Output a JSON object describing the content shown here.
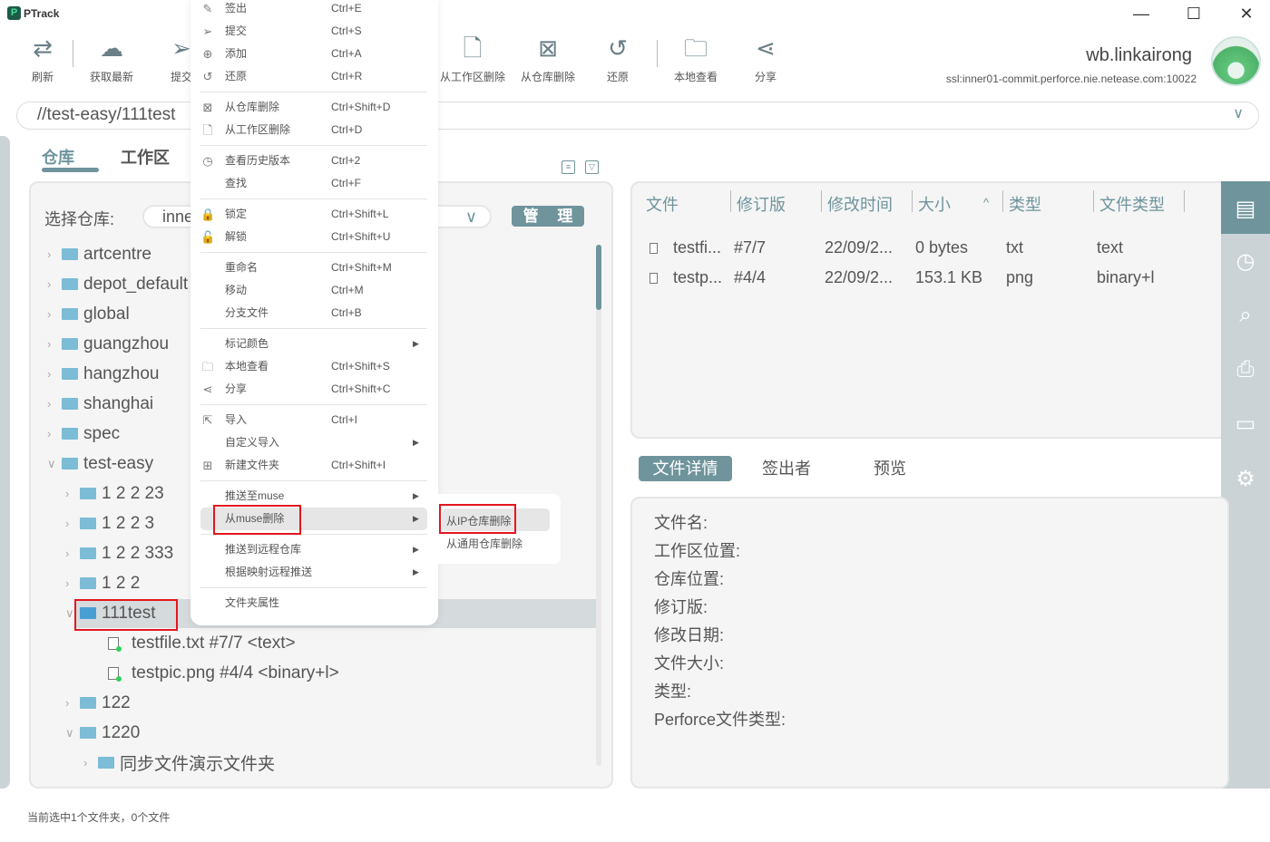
{
  "app": {
    "title": "PTrack",
    "colors": {
      "accent": "#6f949c",
      "highlight_box": "#e3161f",
      "status_dot": "#2ed15a"
    }
  },
  "window_controls": {
    "minimize": "—",
    "maximize": "☐",
    "close": "✕"
  },
  "toolbar": [
    {
      "label": "刷新",
      "icon": "refresh-icon",
      "glyph": "⇄"
    },
    {
      "label": "获取最新",
      "icon": "cloud-download-icon",
      "glyph": "☁"
    },
    {
      "label": "提交",
      "icon": "send-icon",
      "glyph": "➢"
    },
    {
      "label": "从工作区删除",
      "icon": "file-delete-icon",
      "glyph": "🗋"
    },
    {
      "label": "从仓库删除",
      "icon": "depot-delete-icon",
      "glyph": "⊠"
    },
    {
      "label": "还原",
      "icon": "revert-icon",
      "glyph": "↺"
    },
    {
      "label": "本地查看",
      "icon": "folder-open-icon",
      "glyph": "🗀"
    },
    {
      "label": "分享",
      "icon": "share-icon",
      "glyph": "⋖"
    }
  ],
  "user": {
    "name": "wb.linkairong",
    "server": "ssl:inner01-commit.perforce.nie.netease.com:10022"
  },
  "path": {
    "value": "//test-easy/111test"
  },
  "tabs": [
    "仓库",
    "工作区"
  ],
  "repo": {
    "label": "选择仓库:",
    "value": "inne",
    "manage": "管 理"
  },
  "tree": [
    {
      "label": "artcentre",
      "level": 0,
      "type": "folder",
      "expanded": false
    },
    {
      "label": "depot_default",
      "level": 0,
      "type": "folder",
      "expanded": false
    },
    {
      "label": "global",
      "level": 0,
      "type": "folder",
      "expanded": false
    },
    {
      "label": "guangzhou",
      "level": 0,
      "type": "folder",
      "expanded": false
    },
    {
      "label": "hangzhou",
      "level": 0,
      "type": "folder",
      "expanded": false
    },
    {
      "label": "shanghai",
      "level": 0,
      "type": "folder",
      "expanded": false
    },
    {
      "label": "spec",
      "level": 0,
      "type": "folder",
      "expanded": false
    },
    {
      "label": "test-easy",
      "level": 0,
      "type": "folder",
      "expanded": true
    },
    {
      "label": "1 2 2 23",
      "level": 1,
      "type": "folder",
      "expanded": false
    },
    {
      "label": "1 2 2 3",
      "level": 1,
      "type": "folder",
      "expanded": false
    },
    {
      "label": "1 2 2 333",
      "level": 1,
      "type": "folder",
      "expanded": false
    },
    {
      "label": "1 2 2",
      "level": 1,
      "type": "folder",
      "expanded": false
    },
    {
      "label": "111test",
      "level": 1,
      "type": "folder",
      "expanded": true,
      "selected": true
    },
    {
      "label": "testfile.txt  #7/7 <text>",
      "level": 2,
      "type": "file"
    },
    {
      "label": "testpic.png  #4/4 <binary+l>",
      "level": 2,
      "type": "file"
    },
    {
      "label": "122",
      "level": 1,
      "type": "folder",
      "expanded": false
    },
    {
      "label": "1220",
      "level": 1,
      "type": "folder",
      "expanded": true
    },
    {
      "label": "同步文件演示文件夹",
      "level": 2,
      "type": "folder",
      "expanded": false
    }
  ],
  "file_table": {
    "columns": [
      "文件",
      "修订版",
      "修改时间",
      "大小",
      "类型",
      "文件类型"
    ],
    "sort_indicator": "^",
    "rows": [
      [
        "testfi...",
        "#7/7",
        "22/09/2...",
        "0 bytes",
        "txt",
        "text"
      ],
      [
        "testp...",
        "#4/4",
        "22/09/2...",
        "153.1 KB",
        "png",
        "binary+l"
      ]
    ]
  },
  "right_sidebar": [
    "file-list-icon",
    "history-icon",
    "search-icon",
    "stamp-icon",
    "monitor-icon",
    "settings-icon"
  ],
  "detail_tabs": [
    "文件详情",
    "签出者",
    "预览"
  ],
  "details": [
    "文件名:",
    "工作区位置:",
    "仓库位置:",
    "修订版:",
    "修改日期:",
    "文件大小:",
    "类型:",
    "Perforce文件类型:"
  ],
  "status": "当前选中1个文件夹，0个文件",
  "context_menu": [
    {
      "label": "签出",
      "shortcut": "Ctrl+E",
      "icon": "✎"
    },
    {
      "label": "提交",
      "shortcut": "Ctrl+S",
      "icon": "➢"
    },
    {
      "label": "添加",
      "shortcut": "Ctrl+A",
      "icon": "⊕"
    },
    {
      "label": "还原",
      "shortcut": "Ctrl+R",
      "icon": "↺"
    },
    {
      "sep": true
    },
    {
      "label": "从仓库删除",
      "shortcut": "Ctrl+Shift+D",
      "icon": "⊠"
    },
    {
      "label": "从工作区删除",
      "shortcut": "Ctrl+D",
      "icon": "🗋"
    },
    {
      "sep": true
    },
    {
      "label": "查看历史版本",
      "shortcut": "Ctrl+2",
      "icon": "◷"
    },
    {
      "label": "查找",
      "shortcut": "Ctrl+F",
      "icon": ""
    },
    {
      "sep": true
    },
    {
      "label": "锁定",
      "shortcut": "Ctrl+Shift+L",
      "icon": "🔒"
    },
    {
      "label": "解锁",
      "shortcut": "Ctrl+Shift+U",
      "icon": "🔓"
    },
    {
      "sep": true
    },
    {
      "label": "重命名",
      "shortcut": "Ctrl+Shift+M",
      "icon": ""
    },
    {
      "label": "移动",
      "shortcut": "Ctrl+M",
      "icon": ""
    },
    {
      "label": "分支文件",
      "shortcut": "Ctrl+B",
      "icon": ""
    },
    {
      "sep": true
    },
    {
      "label": "标记颜色",
      "shortcut": "",
      "icon": "",
      "submenu": true
    },
    {
      "label": "本地查看",
      "shortcut": "Ctrl+Shift+S",
      "icon": "🗀"
    },
    {
      "label": "分享",
      "shortcut": "Ctrl+Shift+C",
      "icon": "⋖"
    },
    {
      "sep": true
    },
    {
      "label": "导入",
      "shortcut": "Ctrl+I",
      "icon": "⇱"
    },
    {
      "label": "自定义导入",
      "shortcut": "",
      "icon": "",
      "submenu": true
    },
    {
      "label": "新建文件夹",
      "shortcut": "Ctrl+Shift+I",
      "icon": "⊞"
    },
    {
      "sep": true
    },
    {
      "label": "推送至muse",
      "shortcut": "",
      "icon": "",
      "submenu": true
    },
    {
      "label": "从muse删除",
      "shortcut": "",
      "icon": "",
      "submenu": true,
      "highlighted": true
    },
    {
      "sep": true
    },
    {
      "label": "推送到远程仓库",
      "shortcut": "",
      "icon": "",
      "submenu": true
    },
    {
      "label": "根据映射远程推送",
      "shortcut": "",
      "icon": "",
      "submenu": true
    },
    {
      "sep": true
    },
    {
      "label": "文件夹属性",
      "shortcut": "",
      "icon": ""
    }
  ],
  "submenu": [
    "从IP仓库删除",
    "从通用仓库删除"
  ],
  "submenu_arrow": "▶"
}
